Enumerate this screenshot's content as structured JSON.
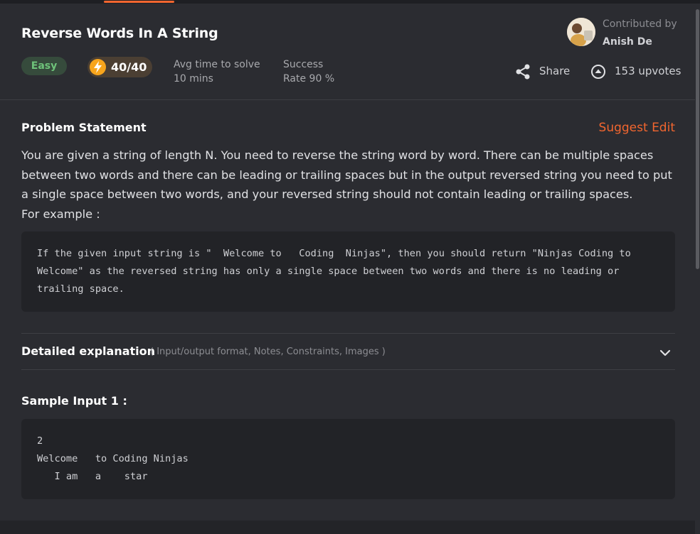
{
  "problem": {
    "title": "Reverse Words In A String",
    "difficulty": "Easy",
    "points": "40/40",
    "avg_time_label": "Avg time to solve",
    "avg_time_value": "10 mins",
    "success_label": "Success",
    "success_value": "Rate 90 %"
  },
  "contributor": {
    "label": "Contributed by",
    "name": "Anish De"
  },
  "actions": {
    "share_label": "Share",
    "upvotes_label": "153 upvotes"
  },
  "statement": {
    "heading": "Problem Statement",
    "suggest_edit": "Suggest Edit",
    "body": "You are given a string of length N. You need to reverse the string word by word. There can be multiple spaces between two words and there can be leading or trailing spaces but in the output reversed string you need to put a single space between two words, and your reversed string should not contain leading or trailing spaces.",
    "example_label": "For example :",
    "example_code": "If the given input string is \"  Welcome to   Coding  Ninjas\", then you should return \"Ninjas Coding to Welcome\" as the reversed string has only a single space between two words and there is no leading or trailing space."
  },
  "details": {
    "title": "Detailed explanation",
    "subtitle": "( Input/output format, Notes, Constraints, Images )"
  },
  "sample": {
    "title": "Sample Input 1 :",
    "code": "2\nWelcome   to Coding Ninjas\n   I am   a    star"
  },
  "colors": {
    "accent": "#f2662f",
    "easy_green": "#6ec37a",
    "background": "#2b2c31",
    "code_bg": "#222327"
  }
}
